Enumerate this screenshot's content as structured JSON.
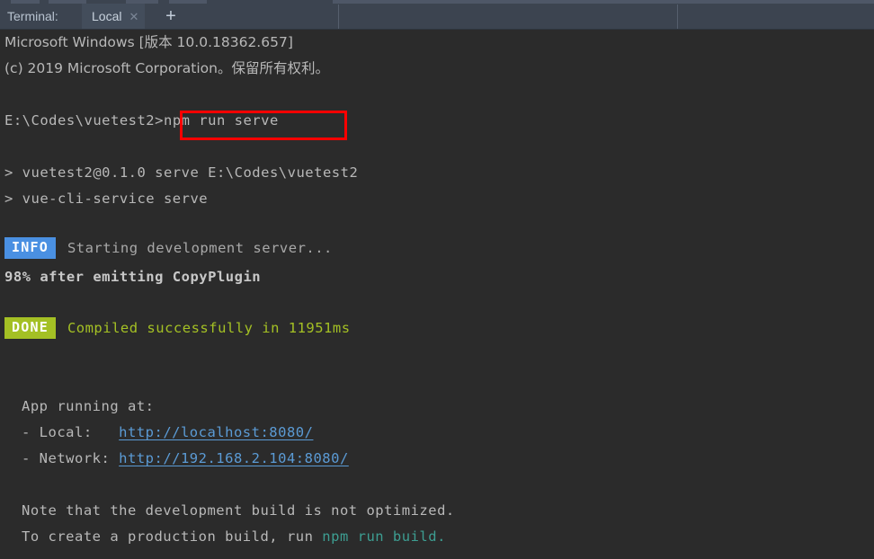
{
  "tab_bar": {
    "terminal_label": "Terminal:",
    "tabs": [
      {
        "title": "Local",
        "close_icon": "close-icon",
        "active": true
      }
    ],
    "add_tab_icon": "plus-icon",
    "colors": {
      "bar_bg": "#3c4450",
      "active_tab_bg": "#434d5b",
      "text": "#c9d3de"
    }
  },
  "terminal": {
    "background": "#2b2b2b",
    "default_text_color": "#b8b8b8",
    "lines": [
      {
        "id": "windows-version",
        "text": "Microsoft Windows [版本 10.0.18362.657]"
      },
      {
        "id": "copyright",
        "text": "(c) 2019 Microsoft Corporation。保留所有权利。"
      },
      {
        "id": "prompt-path",
        "text": "E:\\Codes\\vuetest2>",
        "command": "npm run serve"
      },
      {
        "id": "npm-package",
        "text": "> vuetest2@0.1.0 serve E:\\Codes\\vuetest2"
      },
      {
        "id": "npm-script",
        "text": "> vue-cli-service serve"
      },
      {
        "id": "info-line",
        "badge": "INFO",
        "text": "Starting development server..."
      },
      {
        "id": "progress-line",
        "text": "98% after emitting CopyPlugin"
      },
      {
        "id": "done-line",
        "badge": "DONE",
        "text": "Compiled successfully in 11951ms"
      },
      {
        "id": "app-running",
        "text": "App running at:"
      },
      {
        "id": "local-url",
        "label": "- Local:   ",
        "url": "http://localhost:8080/"
      },
      {
        "id": "network-url",
        "label": "- Network: ",
        "url": "http://192.168.2.104:8080/"
      },
      {
        "id": "note-1",
        "text": "Note that the development build is not optimized."
      },
      {
        "id": "note-2",
        "prefix": "To create a production build, run ",
        "command": "npm run build",
        "suffix": "."
      }
    ]
  },
  "annotation": {
    "type": "red-rectangle",
    "color": "#fe0000",
    "targets": "npm run serve"
  }
}
